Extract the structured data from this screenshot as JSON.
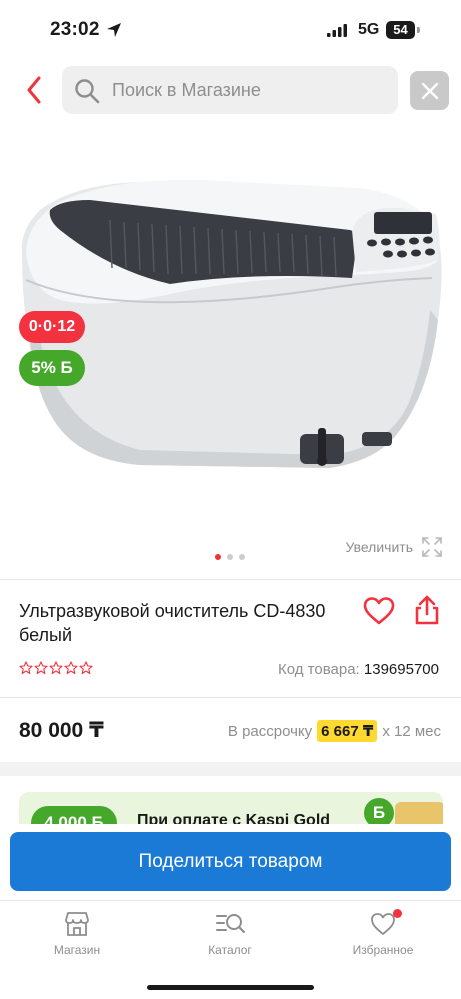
{
  "status_bar": {
    "time": "23:02",
    "network": "5G",
    "battery": "54"
  },
  "header": {
    "search_placeholder": "Поиск в Магазине"
  },
  "gallery": {
    "promo_installment": "0·0·12",
    "promo_bonus": "5% Б",
    "zoom_label": "Увеличить",
    "page_count": 3,
    "active_page": 1
  },
  "product": {
    "title": "Ультразвуковой очиститель CD-4830 белый",
    "rating_stars": 0,
    "code_label": "Код товара:",
    "code_value": "139695700",
    "price": "80 000 ₸",
    "installment_label": "В рассрочку",
    "installment_amount": "6 667 ₸",
    "installment_term": "х 12 мес"
  },
  "gold_banner": {
    "amount": "4 000 Б",
    "text": "При оплате с Kaspi Gold",
    "coin": "Б"
  },
  "share_button": {
    "label": "Поделиться товаром"
  },
  "tabbar": {
    "items": [
      {
        "label": "Магазин",
        "icon": "store-icon"
      },
      {
        "label": "Каталог",
        "icon": "catalog-search-icon"
      },
      {
        "label": "Избранное",
        "icon": "heart-icon"
      }
    ]
  },
  "colors": {
    "accent_red": "#f2333f",
    "bonus_green": "#46a82b",
    "primary_blue": "#1a7ad6",
    "highlight_yellow": "#ffd830"
  }
}
